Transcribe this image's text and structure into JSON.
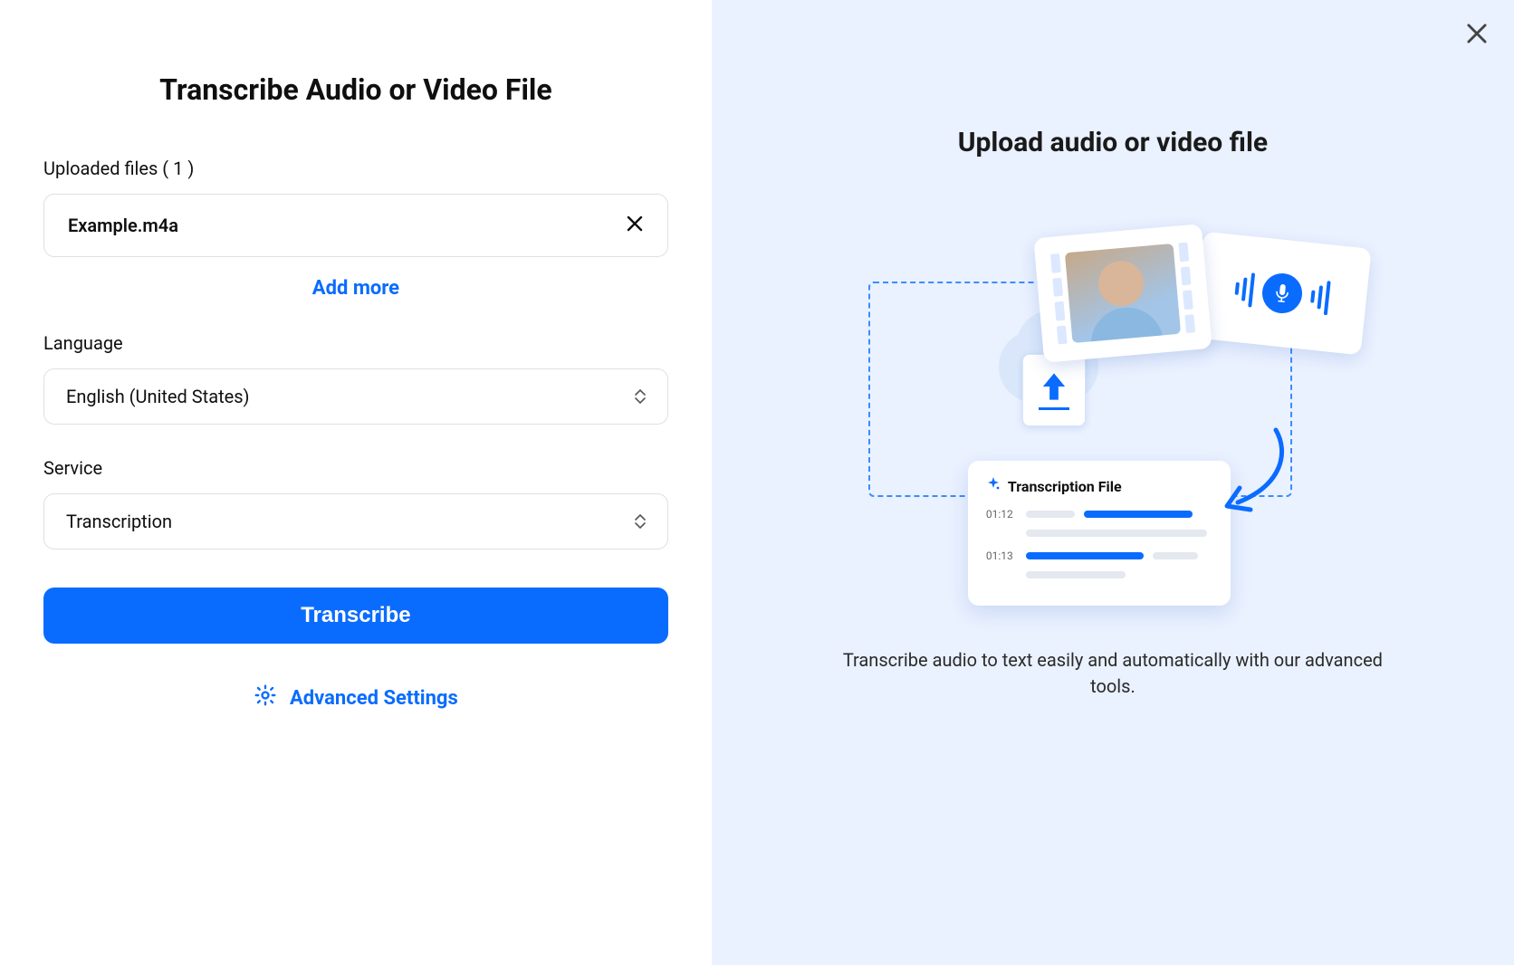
{
  "left": {
    "title": "Transcribe Audio or Video File",
    "uploaded_label": "Uploaded files ( 1 )",
    "file_name": "Example.m4a",
    "add_more": "Add more",
    "language_label": "Language",
    "language_value": "English (United States)",
    "service_label": "Service",
    "service_value": "Transcription",
    "transcribe_btn": "Transcribe",
    "advanced_settings": "Advanced Settings"
  },
  "right": {
    "title": "Upload audio or video file",
    "transcription_card_title": "Transcription File",
    "timestamps": {
      "t1": "01:12",
      "t2": "01:13"
    },
    "description": "Transcribe audio to text easily and automatically with our advanced tools."
  }
}
